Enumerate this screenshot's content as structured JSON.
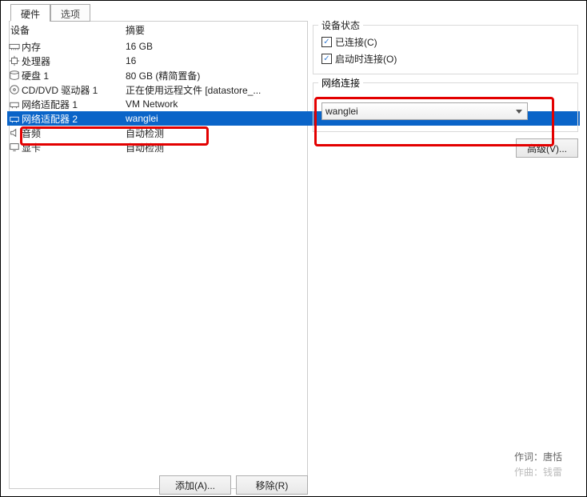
{
  "tabs": {
    "t0": "硬件",
    "t1": "选项"
  },
  "table_headers": {
    "device": "设备",
    "summary": "摘要"
  },
  "devices": {
    "d0": {
      "name": "内存",
      "summary": "16 GB"
    },
    "d1": {
      "name": "处理器",
      "summary": "16"
    },
    "d2": {
      "name": "硬盘 1",
      "summary": "80 GB (精简置备)"
    },
    "d3": {
      "name": "CD/DVD 驱动器 1",
      "summary": "正在使用远程文件 [datastore_..."
    },
    "d4": {
      "name": "网络适配器 1",
      "summary": "VM Network"
    },
    "d5": {
      "name": "网络适配器 2",
      "summary": "wanglei"
    },
    "d6": {
      "name": "音频",
      "summary": "自动检测"
    },
    "d7": {
      "name": "显卡",
      "summary": "自动检测"
    }
  },
  "device_status": {
    "legend": "设备状态",
    "connected": "已连接(C)",
    "connect_at_poweron": "启动时连接(O)"
  },
  "network_connection": {
    "legend": "网络连接",
    "selected": "wanglei"
  },
  "buttons": {
    "advanced": "高级(V)...",
    "add": "添加(A)...",
    "remove": "移除(R)"
  },
  "credits": {
    "lyricist": "作词：唐恬",
    "composer": "作曲：钱雷"
  },
  "checkbox_mark": "✓"
}
